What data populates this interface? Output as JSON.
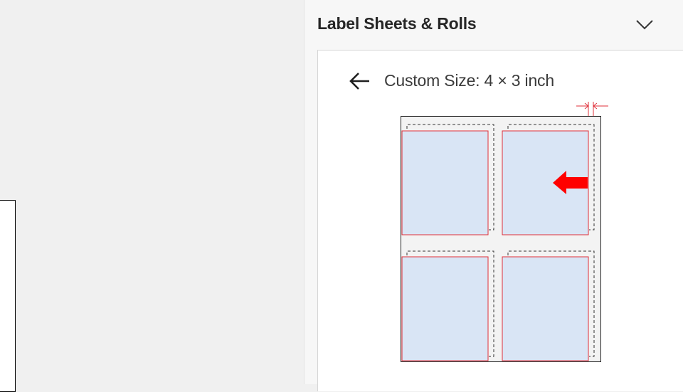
{
  "panel": {
    "title": "Label Sheets & Rolls",
    "collapse_icon": "chevron-down-icon",
    "back_icon": "arrow-left-icon",
    "custom_size_label": "Custom Size: 4 × 3 inch"
  },
  "diagram": {
    "label_count": 4,
    "columns": 2,
    "rows": 2,
    "label_fill": "#d9e5f5",
    "label_border": "#e0303a",
    "arrow_color": "#ff0000",
    "arrow_icon": "arrow-left-icon",
    "dimension_marker_icon": "gap-dimension-icon"
  },
  "colors": {
    "workspace_bg": "#f0f0f0",
    "panel_bg": "#f7f7f7",
    "body_bg": "#ffffff"
  }
}
